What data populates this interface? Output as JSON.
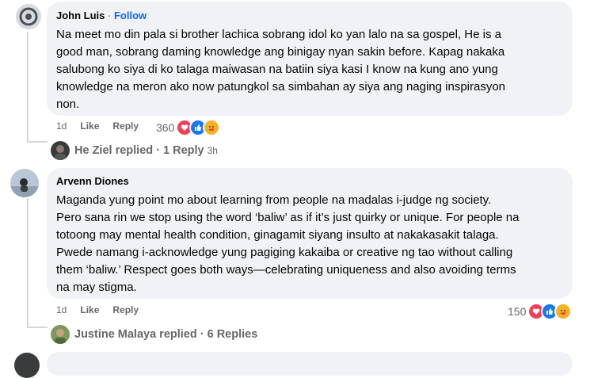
{
  "comments": [
    {
      "author": "John Luis",
      "separator": "·",
      "follow_label": "Follow",
      "text_lines": [
        "Na meet mo din pala si brother lachica sobrang idol ko yan lalo na sa gospel, He is a",
        "good man, sobrang daming knowledge ang binigay nyan sakin before. Kapag nakaka",
        "salubong ko siya di ko talaga maiwasan na batiin siya kasi I know na kung ano yung",
        "knowledge na meron ako now patungkol sa simbahan ay siya ang naging inspirasyon",
        "non."
      ],
      "time": "1d",
      "like_label": "Like",
      "reply_label": "Reply",
      "reaction_count": "360",
      "reaction_icons": [
        "heart-icon",
        "like-icon",
        "care-icon"
      ],
      "reply_summary": {
        "text": "He Ziel replied · 1 Reply",
        "time": "3h"
      }
    },
    {
      "author": "Arvenn Diones",
      "text_lines": [
        "Maganda yung point mo about learning from people na madalas i-judge ng society.",
        "Pero sana rin we stop using the word ‘baliw’ as if it’s just quirky or unique. For people na",
        "totoong may mental health condition, ginagamit siyang insulto at nakakasakit talaga.",
        "Pwede namang i-acknowledge yung pagiging kakaiba or creative ng tao without calling",
        "them ‘baliw.’ Respect goes both ways—celebrating uniqueness and also avoiding terms",
        "na may stigma."
      ],
      "time": "1d",
      "like_label": "Like",
      "reply_label": "Reply",
      "reaction_count": "150",
      "reaction_icons": [
        "heart-icon",
        "like-icon",
        "care-icon"
      ],
      "reply_summary": {
        "text": "Justine Malaya replied · 6 Replies"
      }
    }
  ],
  "colors": {
    "bubble": "#f0f2f5",
    "meta": "#65676b",
    "link": "#0866ff",
    "love": "#f33e58",
    "like": "#1877f2",
    "care": "#f7b125"
  }
}
